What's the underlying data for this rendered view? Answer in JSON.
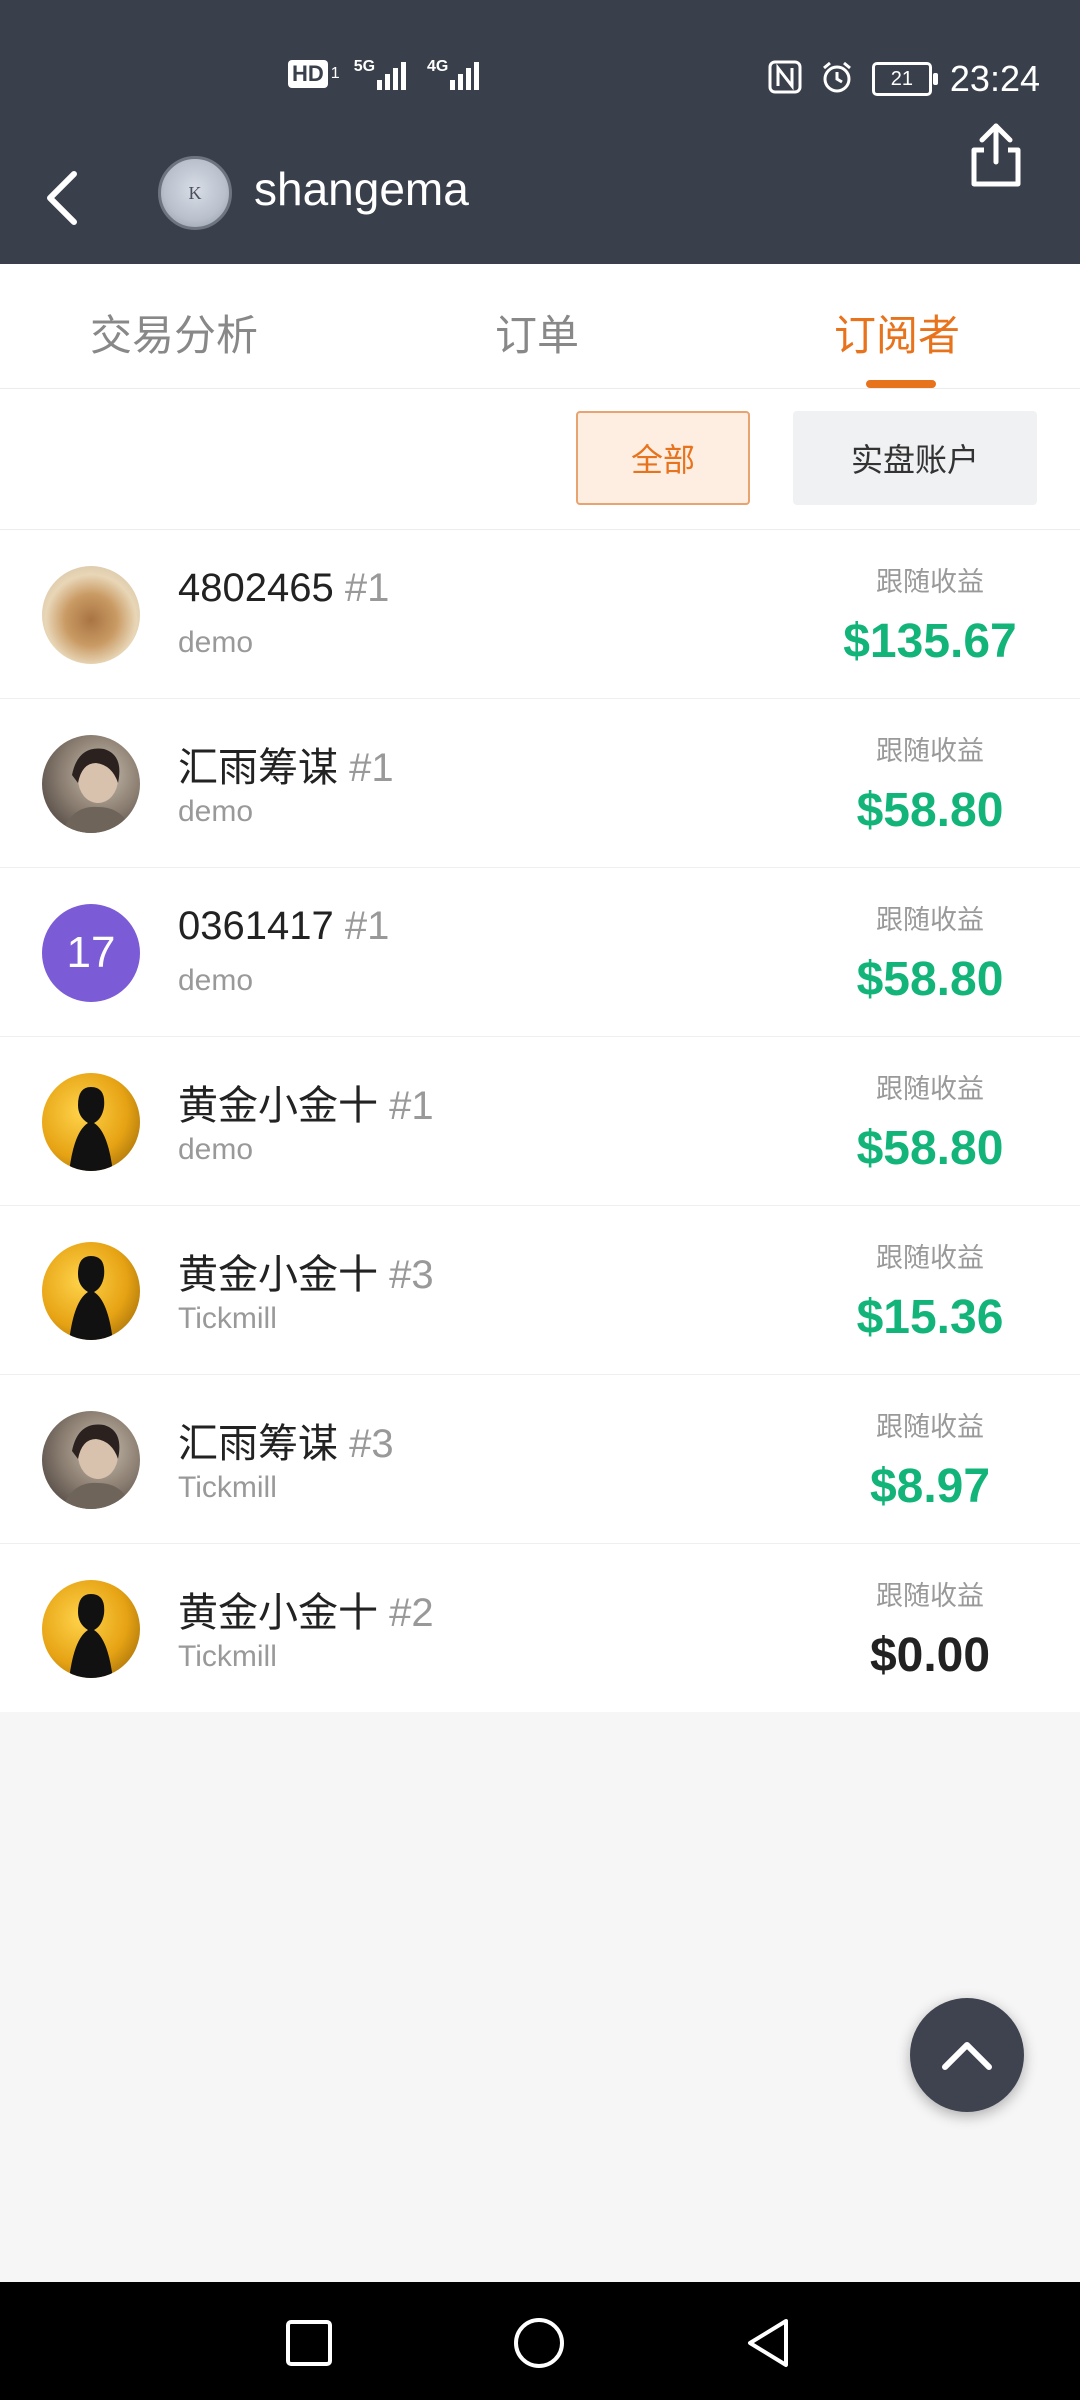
{
  "status_bar": {
    "left_icons": [
      "hd-icon",
      "signal-5g-icon",
      "signal-4g-icon"
    ],
    "hd": "HD",
    "net1": "5G",
    "net2": "4G",
    "battery": "21",
    "time": "23:24"
  },
  "header": {
    "avatar_text": "K",
    "username": "shangema"
  },
  "tabs": [
    {
      "label": "交易分析"
    },
    {
      "label": "订单"
    },
    {
      "label": "订阅者"
    }
  ],
  "active_tab": "订阅者",
  "filters": {
    "all": "全部",
    "real": "实盘账户"
  },
  "subscribers": [
    {
      "name": "4802465",
      "rank": "#1",
      "broker": "demo",
      "earn_label": "跟随收益",
      "earn": "$135.67",
      "avatar": "food"
    },
    {
      "name": "汇雨筹谋",
      "rank": "#1",
      "broker": "demo",
      "earn_label": "跟随收益",
      "earn": "$58.80",
      "avatar": "girl"
    },
    {
      "name": "0361417",
      "rank": "#1",
      "broker": "demo",
      "earn_label": "跟随收益",
      "earn": "$58.80",
      "avatar": "17"
    },
    {
      "name": "黄金小金十",
      "rank": "#1",
      "broker": "demo",
      "earn_label": "跟随收益",
      "earn": "$58.80",
      "avatar": "gold"
    },
    {
      "name": "黄金小金十",
      "rank": "#3",
      "broker": "Tickmill",
      "earn_label": "跟随收益",
      "earn": "$15.36",
      "avatar": "gold"
    },
    {
      "name": "汇雨筹谋",
      "rank": "#3",
      "broker": "Tickmill",
      "earn_label": "跟随收益",
      "earn": "$8.97",
      "avatar": "girl"
    },
    {
      "name": "黄金小金十",
      "rank": "#2",
      "broker": "Tickmill",
      "earn_label": "跟随收益",
      "earn": "$0.00",
      "avatar": "gold"
    }
  ],
  "colors": {
    "header_bg": "#393f4b",
    "accent": "#e8731d",
    "positive": "#12b47a"
  }
}
